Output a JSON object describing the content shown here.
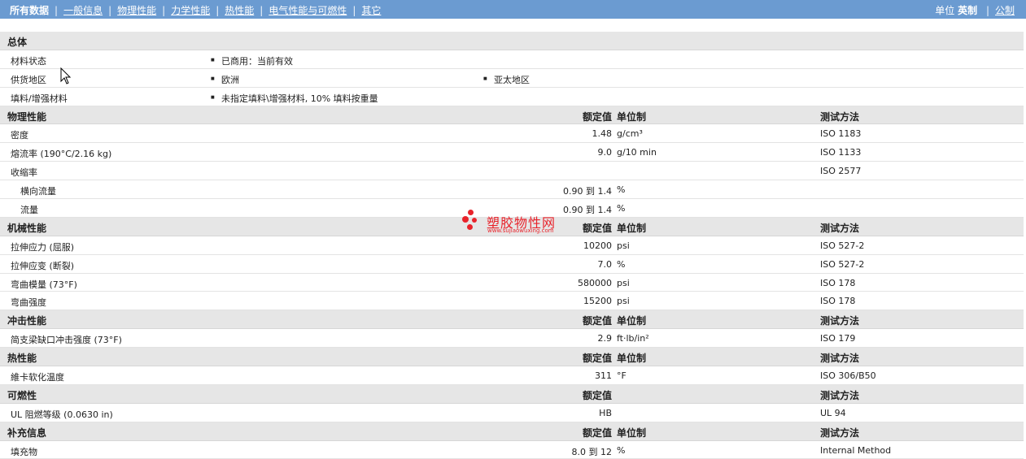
{
  "nav": {
    "items": [
      "所有数据",
      "一般信息",
      "物理性能",
      "力学性能",
      "热性能",
      "电气性能与可燃性",
      "其它"
    ],
    "units_label": "单位",
    "units_active": "英制",
    "units_other": "公制"
  },
  "general": {
    "title": "总体",
    "status_label": "材料状态",
    "status_value": "已商用：当前有效",
    "region_label": "供货地区",
    "region_1": "欧洲",
    "region_2": "亚太地区",
    "filler_label": "填料/增强材料",
    "filler_value": "未指定填料\\增强材料, 10% 填料按重量"
  },
  "headers": {
    "value": "额定值",
    "unit": "单位制",
    "method": "测试方法"
  },
  "physical": {
    "title": "物理性能",
    "rows": [
      {
        "name": "密度",
        "value": "1.48",
        "unit": "g/cm³",
        "method": "ISO 1183"
      },
      {
        "name": "熔流率 (190°C/2.16 kg)",
        "value": "9.0",
        "unit": "g/10 min",
        "method": "ISO 1133"
      },
      {
        "name": "收缩率",
        "value": "",
        "unit": "",
        "method": "ISO 2577"
      },
      {
        "name": "横向流量",
        "value": "0.90 到  1.4",
        "unit": "%",
        "method": ""
      },
      {
        "name": "流量",
        "value": "0.90 到  1.4",
        "unit": "%",
        "method": ""
      }
    ]
  },
  "mechanical": {
    "title": "机械性能",
    "rows": [
      {
        "name": "拉伸应力 (屈服)",
        "value": "10200",
        "unit": "psi",
        "method": "ISO 527-2"
      },
      {
        "name": "拉伸应变 (断裂)",
        "value": "7.0",
        "unit": "%",
        "method": "ISO 527-2"
      },
      {
        "name": "弯曲模量 (73°F)",
        "value": "580000",
        "unit": "psi",
        "method": "ISO 178"
      },
      {
        "name": "弯曲强度",
        "value": "15200",
        "unit": "psi",
        "method": "ISO 178"
      }
    ]
  },
  "impact": {
    "title": "冲击性能",
    "rows": [
      {
        "name": "简支梁缺口冲击强度 (73°F)",
        "value": "2.9",
        "unit": "ft·lb/in²",
        "method": "ISO 179"
      }
    ]
  },
  "thermal": {
    "title": "热性能",
    "rows": [
      {
        "name": "維卡软化温度",
        "value": "311",
        "unit": "°F",
        "method": "ISO 306/B50"
      }
    ]
  },
  "flammability": {
    "title": "可燃性",
    "rows": [
      {
        "name": "UL 阻燃等级 (0.0630 in)",
        "value": "HB",
        "unit": "",
        "method": "UL 94"
      }
    ]
  },
  "supplementary": {
    "title": "补充信息",
    "rows": [
      {
        "name": "填充物",
        "value": "8.0 到  12",
        "unit": "%",
        "method": "Internal Method"
      }
    ]
  },
  "watermark": {
    "cn": "塑胶物性网",
    "en": "www.sujiaowuxing.com",
    "color": "#e8232b"
  },
  "colors": {
    "topbar": "#6b9bd1",
    "section": "#e6e6e6"
  }
}
